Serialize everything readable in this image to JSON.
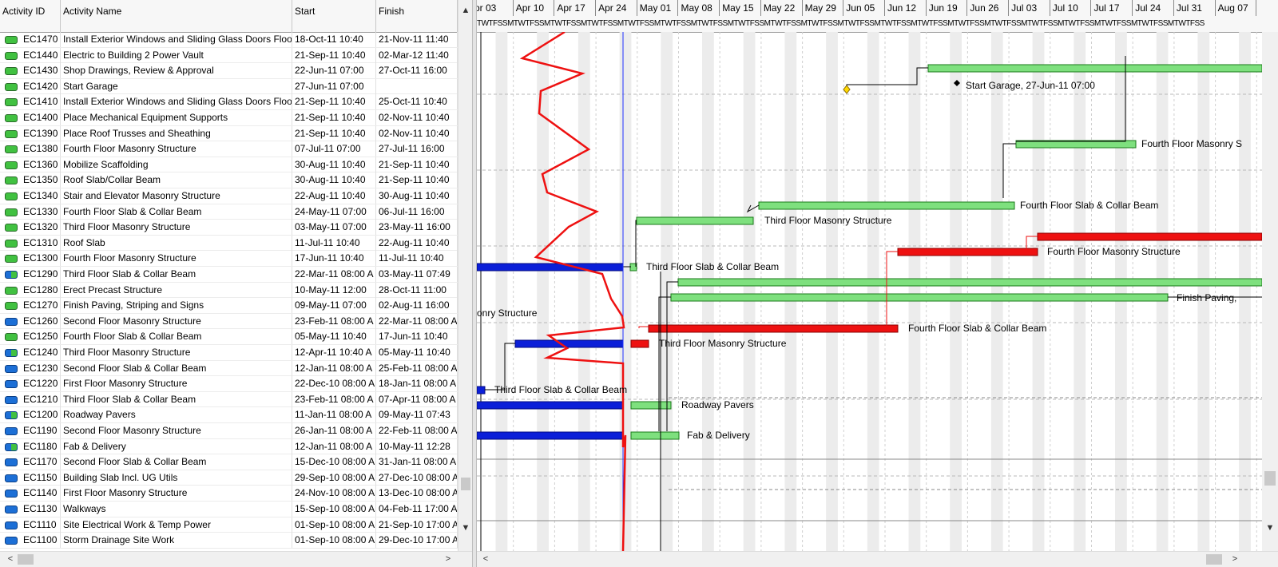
{
  "columns": {
    "id": "Activity ID",
    "name": "Activity Name",
    "start": "Start",
    "finish": "Finish"
  },
  "activities": [
    {
      "id": "EC1470",
      "name": "Install Exterior Windows and Sliding Glass Doors Floor 2",
      "start": "18-Oct-11 10:40",
      "finish": "21-Nov-11 11:40",
      "icon": "green"
    },
    {
      "id": "EC1440",
      "name": "Electric to Building 2 Power Vault",
      "start": "21-Sep-11 10:40",
      "finish": "02-Mar-12 11:40",
      "icon": "green"
    },
    {
      "id": "EC1430",
      "name": "Shop Drawings, Review & Approval",
      "start": "22-Jun-11 07:00",
      "finish": "27-Oct-11 16:00",
      "icon": "green"
    },
    {
      "id": "EC1420",
      "name": "Start Garage",
      "start": "27-Jun-11 07:00",
      "finish": "",
      "icon": "green"
    },
    {
      "id": "EC1410",
      "name": "Install Exterior Windows and Sliding Glass Doors Floor 1",
      "start": "21-Sep-11 10:40",
      "finish": "25-Oct-11 10:40",
      "icon": "green"
    },
    {
      "id": "EC1400",
      "name": "Place Mechanical Equipment Supports",
      "start": "21-Sep-11 10:40",
      "finish": "02-Nov-11 10:40",
      "icon": "green"
    },
    {
      "id": "EC1390",
      "name": "Place Roof Trusses and Sheathing",
      "start": "21-Sep-11 10:40",
      "finish": "02-Nov-11 10:40",
      "icon": "green"
    },
    {
      "id": "EC1380",
      "name": "Fourth Floor Masonry Structure",
      "start": "07-Jul-11 07:00",
      "finish": "27-Jul-11 16:00",
      "icon": "green"
    },
    {
      "id": "EC1360",
      "name": "Mobilize Scaffolding",
      "start": "30-Aug-11 10:40",
      "finish": "21-Sep-11 10:40",
      "icon": "green"
    },
    {
      "id": "EC1350",
      "name": "Roof Slab/Collar Beam",
      "start": "30-Aug-11 10:40",
      "finish": "21-Sep-11 10:40",
      "icon": "green"
    },
    {
      "id": "EC1340",
      "name": "Stair and Elevator Masonry Structure",
      "start": "22-Aug-11 10:40",
      "finish": "30-Aug-11 10:40",
      "icon": "green"
    },
    {
      "id": "EC1330",
      "name": "Fourth Floor Slab & Collar Beam",
      "start": "24-May-11 07:00",
      "finish": "06-Jul-11 16:00",
      "icon": "green"
    },
    {
      "id": "EC1320",
      "name": "Third Floor Masonry Structure",
      "start": "03-May-11 07:00",
      "finish": "23-May-11 16:00",
      "icon": "green"
    },
    {
      "id": "EC1310",
      "name": "Roof Slab",
      "start": "11-Jul-11 10:40",
      "finish": "22-Aug-11 10:40",
      "icon": "green"
    },
    {
      "id": "EC1300",
      "name": "Fourth Floor Masonry Structure",
      "start": "17-Jun-11 10:40",
      "finish": "11-Jul-11 10:40",
      "icon": "green"
    },
    {
      "id": "EC1290",
      "name": "Third Floor Slab & Collar Beam",
      "start": "22-Mar-11 08:00 A",
      "finish": "03-May-11 07:49",
      "icon": "mixed"
    },
    {
      "id": "EC1280",
      "name": "Erect Precast Structure",
      "start": "10-May-11 12:00",
      "finish": "28-Oct-11 11:00",
      "icon": "green"
    },
    {
      "id": "EC1270",
      "name": "Finish Paving, Striping and Signs",
      "start": "09-May-11 07:00",
      "finish": "02-Aug-11 16:00",
      "icon": "green"
    },
    {
      "id": "EC1260",
      "name": "Second Floor Masonry Structure",
      "start": "23-Feb-11 08:00 A",
      "finish": "22-Mar-11 08:00 A",
      "icon": "blue"
    },
    {
      "id": "EC1250",
      "name": "Fourth Floor Slab & Collar Beam",
      "start": "05-May-11 10:40",
      "finish": "17-Jun-11 10:40",
      "icon": "green"
    },
    {
      "id": "EC1240",
      "name": "Third Floor Masonry Structure",
      "start": "12-Apr-11 10:40 A",
      "finish": "05-May-11 10:40",
      "icon": "mixed"
    },
    {
      "id": "EC1230",
      "name": "Second Floor Slab & Collar Beam",
      "start": "12-Jan-11 08:00 A",
      "finish": "25-Feb-11 08:00 A",
      "icon": "blue"
    },
    {
      "id": "EC1220",
      "name": "First Floor Masonry Structure",
      "start": "22-Dec-10 08:00 A",
      "finish": "18-Jan-11 08:00 A",
      "icon": "blue"
    },
    {
      "id": "EC1210",
      "name": "Third Floor Slab & Collar Beam",
      "start": "23-Feb-11 08:00 A",
      "finish": "07-Apr-11 08:00 A",
      "icon": "blue"
    },
    {
      "id": "EC1200",
      "name": "Roadway Pavers",
      "start": "11-Jan-11 08:00 A",
      "finish": "09-May-11 07:43",
      "icon": "mixed"
    },
    {
      "id": "EC1190",
      "name": "Second Floor Masonry Structure",
      "start": "26-Jan-11 08:00 A",
      "finish": "22-Feb-11 08:00 A",
      "icon": "blue"
    },
    {
      "id": "EC1180",
      "name": "Fab & Delivery",
      "start": "12-Jan-11 08:00 A",
      "finish": "10-May-11 12:28",
      "icon": "mixed"
    },
    {
      "id": "EC1170",
      "name": "Second Floor Slab & Collar Beam",
      "start": "15-Dec-10 08:00 A",
      "finish": "31-Jan-11 08:00 A",
      "icon": "blue"
    },
    {
      "id": "EC1150",
      "name": "Building Slab Incl. UG Utils",
      "start": "29-Sep-10 08:00 A",
      "finish": "27-Dec-10 08:00 A",
      "icon": "blue"
    },
    {
      "id": "EC1140",
      "name": "First Floor Masonry Structure",
      "start": "24-Nov-10 08:00 A",
      "finish": "13-Dec-10 08:00 A",
      "icon": "blue"
    },
    {
      "id": "EC1130",
      "name": "Walkways",
      "start": "15-Sep-10 08:00 A",
      "finish": "04-Feb-11 17:00 A",
      "icon": "blue"
    },
    {
      "id": "EC1110",
      "name": "Site Electrical Work & Temp Power",
      "start": "01-Sep-10 08:00 A",
      "finish": "21-Sep-10 17:00 A",
      "icon": "blue"
    },
    {
      "id": "EC1100",
      "name": "Storm Drainage Site Work",
      "start": "01-Sep-10 08:00 A",
      "finish": "29-Dec-10 17:00 A",
      "icon": "blue"
    }
  ],
  "timescale": {
    "weeks": [
      "pr 03",
      "Apr 10",
      "Apr 17",
      "Apr 24",
      "May 01",
      "May 08",
      "May 15",
      "May 22",
      "May 29",
      "Jun 05",
      "Jun 12",
      "Jun 19",
      "Jun 26",
      "Jul 03",
      "Jul 10",
      "Jul 17",
      "Jul 24",
      "Jul 31",
      "Aug 07"
    ],
    "days": "TWTFSSMTWTFSSMTWTFSSMTWTFSSMTWTFSSMTWTFSSMTWTFSSMTWTFSSMTWTFSSMTWTFSSMTWTFSSMTWTFSSMTWTFSSMTWTFSSMTWTFSSMTWTFSSMTWTFSSMTWTFSSMTWTFSSMTWTFSS"
  },
  "bar_labels": {
    "start_garage": "Start Garage, 27-Jun-11 07:00",
    "l1380": "Fourth Floor Masonry S",
    "l1330": "Fourth Floor Slab & Collar Beam",
    "l1320": "Third Floor Masonry Structure",
    "l1300": "Fourth Floor Masonry Structure",
    "l1290": "Third Floor Slab & Collar Beam",
    "l1270": "Finish Paving,",
    "l1260": "sonry Structure",
    "l1250": "Fourth Floor Slab & Collar Beam",
    "l1240": "Third Floor Masonry Structure",
    "l1210": "Third Floor Slab & Collar Beam",
    "l1200": "Roadway Pavers",
    "l1180": "Fab & Delivery"
  },
  "scroll": {
    "up": "▲",
    "down": "▼",
    "left": "<",
    "right": ">"
  },
  "colors": {
    "planned": "#7ee07e",
    "critical": "#ee1111",
    "actual": "#0b1fd8",
    "data_date": "#2030ff",
    "progress_line": "#ee1111"
  }
}
